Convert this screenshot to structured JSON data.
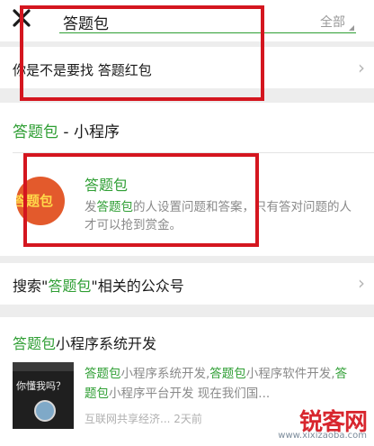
{
  "search": {
    "query": "答题包",
    "filter_label": "全部"
  },
  "suggestion": {
    "text": "你是不是要找 答题红包"
  },
  "mini_program_section": {
    "title_highlight": "答题包",
    "title_rest": " - 小程序",
    "app_name": "答题包",
    "icon_text": "答题包",
    "desc_prefix": "发",
    "desc_highlight": "答题包",
    "desc_rest": "的人设置问题和答案，只有答对问题的人才可以抢到赏金。"
  },
  "accounts_row": {
    "prefix": "搜索\"",
    "highlight": "答题包",
    "suffix": "\"相关的公众号"
  },
  "article": {
    "title_highlight": "答题包",
    "title_rest": "小程序系统开发",
    "thumb_text": "你懂我吗？",
    "summary_h1": "答题包",
    "summary_t1": "小程序系统开发,",
    "summary_h2": "答题包",
    "summary_t2": "小程序软件开发,",
    "summary_h3": "答题包",
    "summary_t3": "小程序平台开发 现在我们国...",
    "meta": "互联网共享经济... 2天前"
  },
  "watermark": {
    "logo": "锐客网",
    "url": "www.xixizaoba.com"
  },
  "colors": {
    "accent_green": "#2e9e33",
    "annotation_red": "#d4161f"
  }
}
